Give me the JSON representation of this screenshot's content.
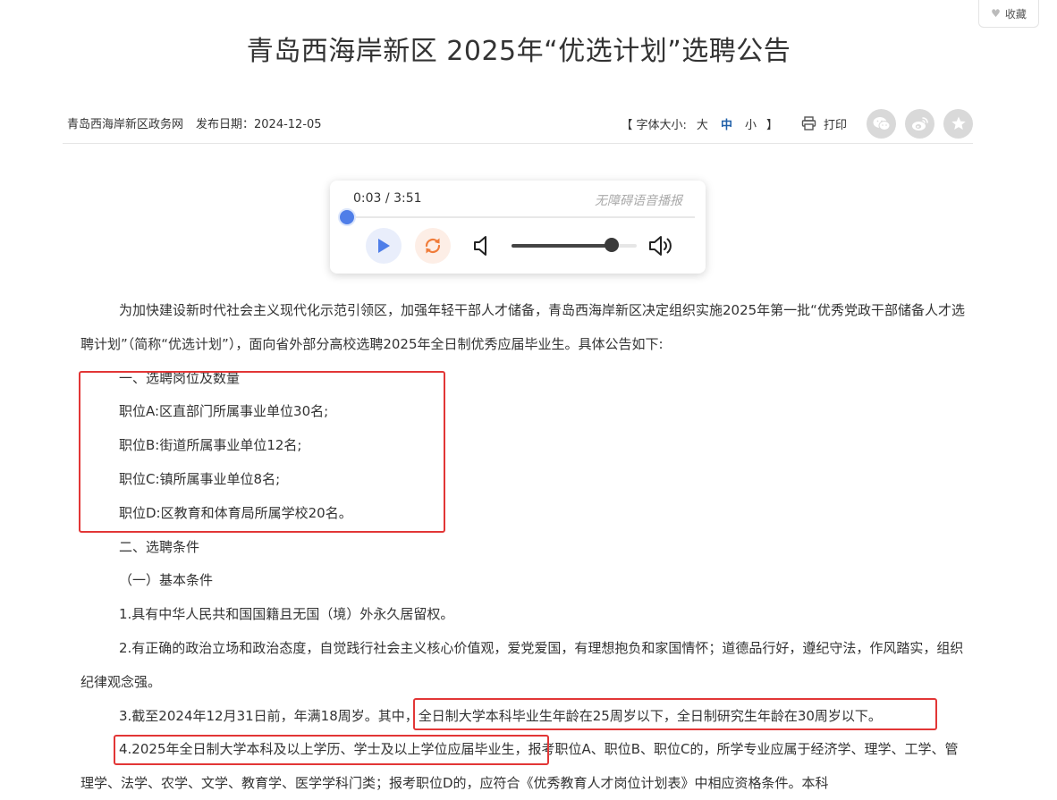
{
  "favorite": {
    "label": "收藏",
    "icon": "heart-icon"
  },
  "article": {
    "title": "青岛西海岸新区 2025年“优选计划”选聘公告",
    "source": "青岛西海岸新区政务网",
    "publish_label": "发布日期：2024-12-05"
  },
  "toolbar": {
    "fontsize_open": "【 字体大小:",
    "size_large": "大",
    "size_medium": "中",
    "size_small": "小",
    "fontsize_close": "】",
    "print_label": "打印",
    "share_icons": [
      "wechat-icon",
      "weibo-icon",
      "star-icon"
    ]
  },
  "player": {
    "current_time": "0:03",
    "separator": "/",
    "duration": "3:51",
    "label": "无障碍语音播报",
    "progress_fraction": 0.013,
    "volume_fraction": 0.8,
    "colors": {
      "accent": "#4f7ee8",
      "loop": "#f07c3a"
    }
  },
  "paragraphs": [
    "为加快建设新时代社会主义现代化示范引领区，加强年轻干部人才储备，青岛西海岸新区决定组织实施2025年第一批“优秀党政干部储备人才选聘计划”（简称“优选计划”），面向省外部分高校选聘2025年全日制优秀应届毕业生。具体公告如下:",
    "一、选聘岗位及数量",
    "职位A:区直部门所属事业单位30名;",
    "职位B:街道所属事业单位12名;",
    "职位C:镇所属事业单位8名;",
    "职位D:区教育和体育局所属学校20名。",
    "二、选聘条件",
    "（一）基本条件",
    "1.具有中华人民共和国国籍且无国（境）外永久居留权。",
    "2.有正确的政治立场和政治态度，自觉践行社会主义核心价值观，爱党爱国，有理想抱负和家国情怀；道德品行好，遵纪守法，作风踏实，组织纪律观念强。",
    "3.截至2024年12月31日前，年满18周岁。其中，全日制大学本科毕业生年龄在25周岁以下，全日制研究生年龄在30周岁以下。",
    "4.2025年全日制大学本科及以上学历、学士及以上学位应届毕业生，报考职位A、职位B、职位C的，所学专业应属于经济学、理学、工学、管理学、法学、农学、文学、教育学、医学学科门类；报考职位D的，应符合《优秀教育人才岗位计划表》中相应资格条件。本科"
  ],
  "highlight_color": "#e23636"
}
